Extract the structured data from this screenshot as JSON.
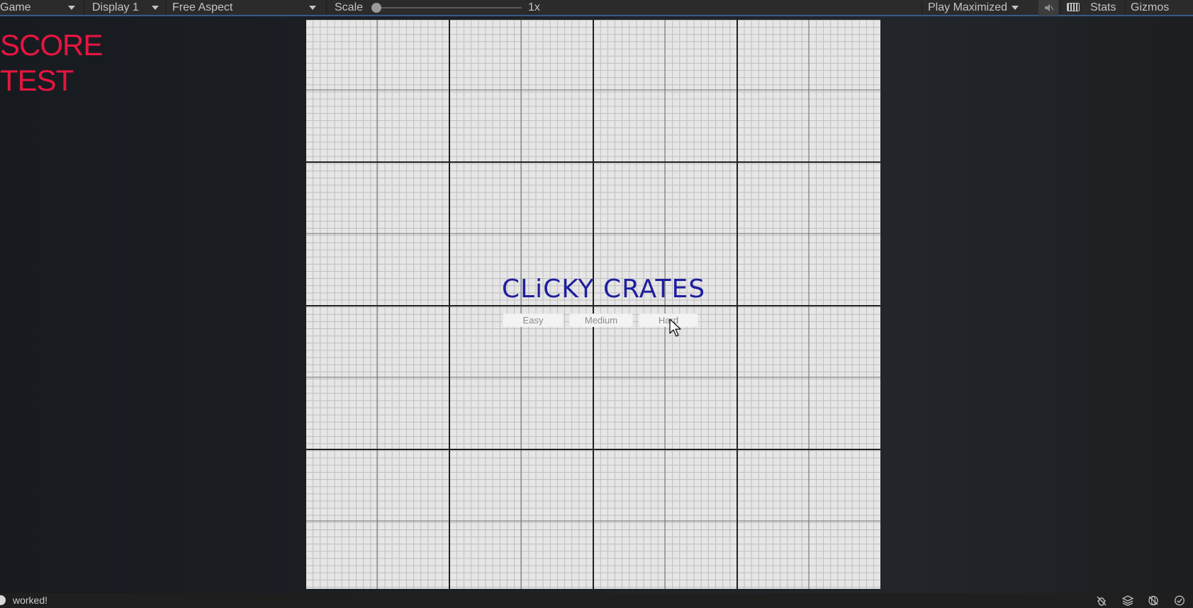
{
  "toolbar": {
    "view_tab": "Game",
    "display": "Display 1",
    "aspect": "Free Aspect",
    "scale_label": "Scale",
    "scale_value": "1x",
    "scale_fraction": 0.0,
    "play_mode": "Play Maximized",
    "stats_label": "Stats",
    "gizmos_label": "Gizmos",
    "mute_icon": "audio-mute-icon",
    "keyboard_icon": "keyboard-icon"
  },
  "hud": {
    "score": "SCORE",
    "test": "TEST",
    "color": "#e5153f"
  },
  "game": {
    "title": "CLiCKY CRATES",
    "title_color": "#1f1f9e",
    "difficulty_buttons": [
      "Easy",
      "Medium",
      "Hard"
    ]
  },
  "status": {
    "message": "worked!",
    "icons": [
      "bug-icon",
      "layers-icon",
      "network-icon",
      "check-icon"
    ]
  }
}
